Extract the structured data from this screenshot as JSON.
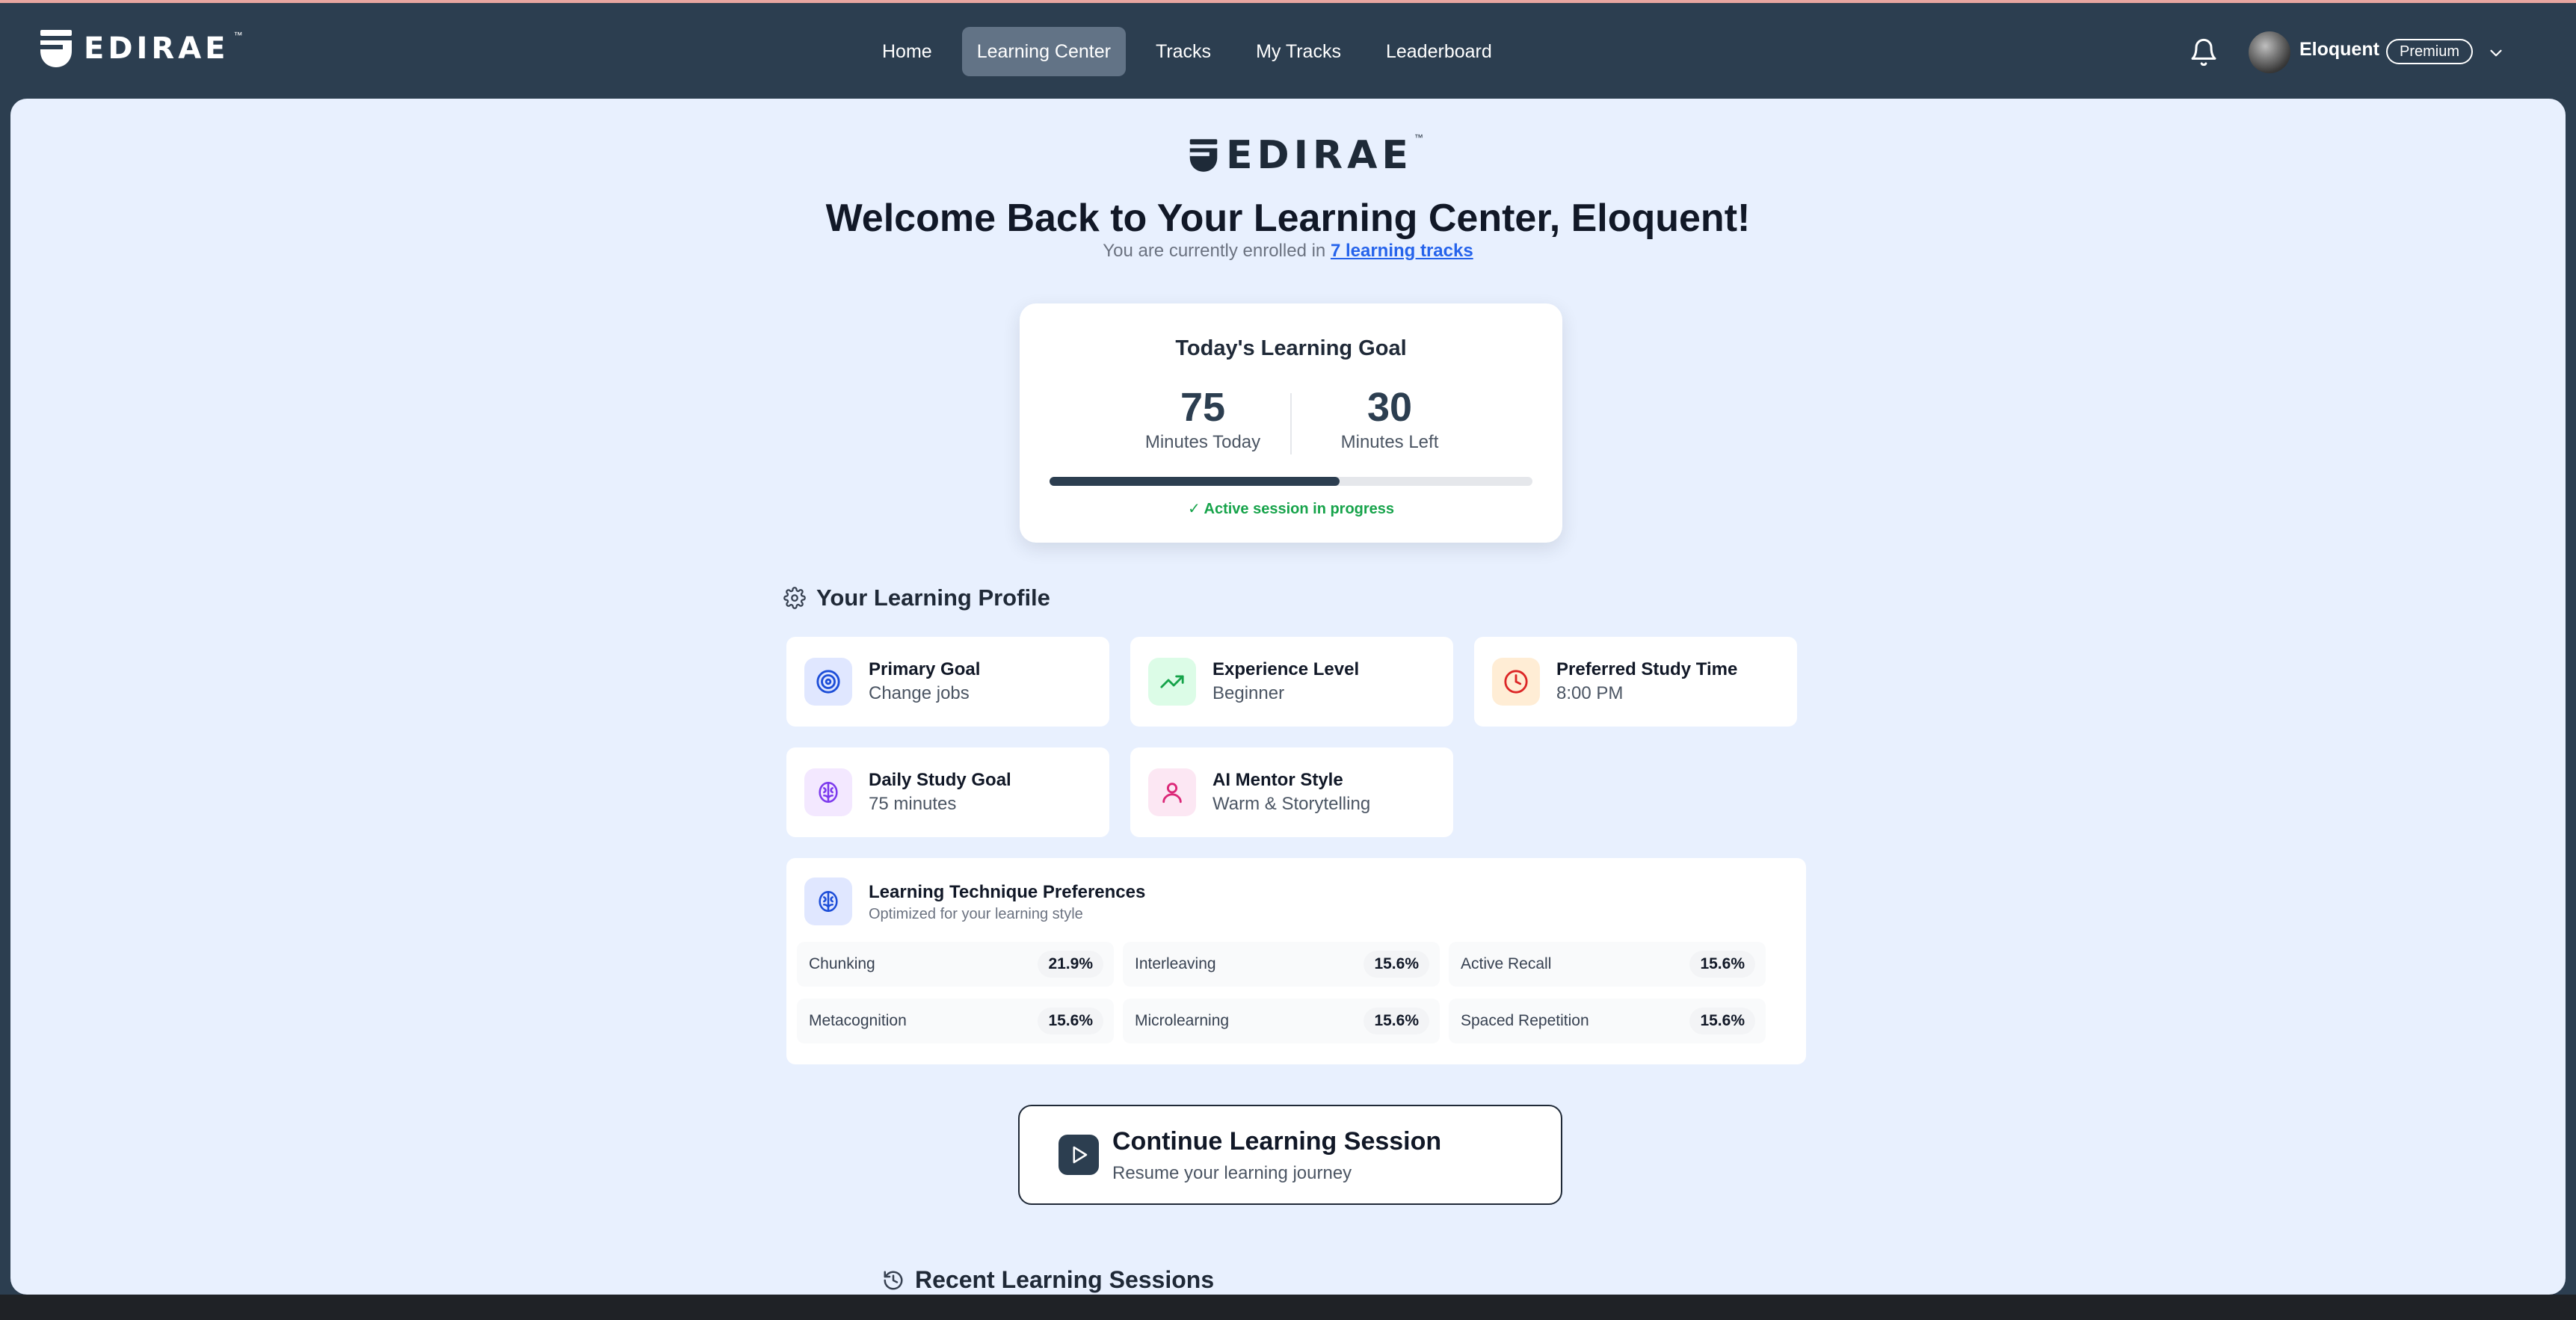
{
  "header": {
    "brand": "EDIRAE",
    "trademark": "™",
    "nav": [
      {
        "label": "Home"
      },
      {
        "label": "Learning Center"
      },
      {
        "label": "Tracks"
      },
      {
        "label": "My Tracks"
      },
      {
        "label": "Leaderboard"
      }
    ],
    "active_nav": "Learning Center",
    "user": {
      "name": "Eloquent",
      "badge": "Premium"
    }
  },
  "hero": {
    "logo": "EDIRAE",
    "trademark": "™",
    "welcome": "Welcome Back to Your Learning Center, Eloquent!",
    "enrolled_prefix": "You are currently enrolled in ",
    "enrolled_link": "7 learning tracks"
  },
  "goal": {
    "title": "Today's Learning Goal",
    "minutes_today": "75",
    "minutes_today_label": "Minutes Today",
    "minutes_left": "30",
    "minutes_left_label": "Minutes Left",
    "progress": 0.6,
    "status": "✓ Active session in progress"
  },
  "profile": {
    "title": "Your Learning Profile",
    "items": [
      {
        "label": "Primary Goal",
        "value": "Change jobs",
        "icon": "target-icon"
      },
      {
        "label": "Experience Level",
        "value": "Beginner",
        "icon": "trending-up-icon"
      },
      {
        "label": "Preferred Study Time",
        "value": "8:00 PM",
        "icon": "clock-icon"
      },
      {
        "label": "Daily Study Goal",
        "value": "75 minutes",
        "icon": "brain-icon"
      },
      {
        "label": "AI Mentor Style",
        "value": "Warm & Storytelling",
        "icon": "user-icon"
      }
    ]
  },
  "techniques": {
    "title": "Learning Technique Preferences",
    "subtitle": "Optimized for your learning style",
    "items": [
      {
        "name": "Chunking",
        "pct": "21.9%"
      },
      {
        "name": "Interleaving",
        "pct": "15.6%"
      },
      {
        "name": "Active Recall",
        "pct": "15.6%"
      },
      {
        "name": "Metacognition",
        "pct": "15.6%"
      },
      {
        "name": "Microlearning",
        "pct": "15.6%"
      },
      {
        "name": "Spaced Repetition",
        "pct": "15.6%"
      }
    ]
  },
  "cta": {
    "title": "Continue Learning Session",
    "subtitle": "Resume your learning journey"
  },
  "recent": {
    "title": "Recent Learning Sessions"
  },
  "colors": {
    "navbar": "#2c3e50",
    "panel_bg": "#e8f0fe",
    "link": "#2563eb",
    "success": "#16a34a"
  }
}
